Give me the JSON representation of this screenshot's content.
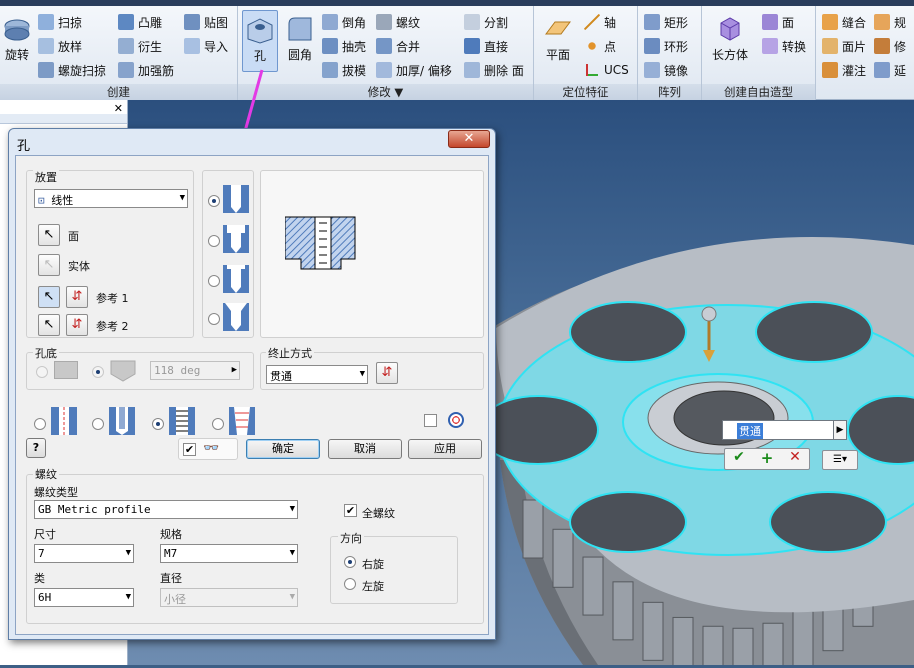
{
  "ribbon": {
    "groups": [
      {
        "label": "创建"
      },
      {
        "label": "修改 ▼"
      },
      {
        "label": "定位特征"
      },
      {
        "label": "阵列"
      },
      {
        "label": "创建自由造型"
      }
    ],
    "create": {
      "revolve": "旋转",
      "sweep": "扫掠",
      "loft": "放样",
      "coil": "螺旋扫掠",
      "emboss": "凸雕",
      "derive": "衍生",
      "rib": "加强筋",
      "decal": "贴图",
      "import": "导入"
    },
    "modify": {
      "hole": "孔",
      "fillet": "圆角",
      "chamfer": "倒角",
      "shell": "抽壳",
      "draft": "拔模",
      "thread": "螺纹",
      "combine": "合并",
      "thicken": "加厚/ 偏移",
      "split": "分割",
      "direct": "直接",
      "delete_face": "删除 面"
    },
    "work": {
      "plane": "平面",
      "axis": "轴",
      "point": "点",
      "ucs": "UCS"
    },
    "pattern": {
      "rect": "矩形",
      "circ": "环形",
      "mirror": "镜像"
    },
    "freeform": {
      "box": "长方体",
      "face": "面",
      "convert": "转换"
    },
    "surface": {
      "stitch": "缝合",
      "patch": "面片",
      "sculpt": "灌注",
      "rule": "规",
      "repair": "修",
      "extend": "延"
    }
  },
  "dialog": {
    "title": "孔",
    "close": "✕",
    "placement": {
      "label": "放置",
      "type": "线性",
      "face": "面",
      "solid": "实体",
      "ref1": "参考 1",
      "ref2": "参考 2"
    },
    "bottom": {
      "label": "孔底",
      "angle": "118 deg"
    },
    "termination": {
      "label": "终止方式",
      "value": "贯通"
    },
    "buttons": {
      "ok": "确定",
      "cancel": "取消",
      "apply": "应用",
      "help": "?"
    },
    "thread": {
      "label": "螺纹",
      "type_label": "螺纹类型",
      "type_value": "GB Metric profile",
      "full_thread": "全螺纹",
      "size_label": "尺寸",
      "size_value": "7",
      "designation_label": "规格",
      "designation_value": "M7",
      "class_label": "类",
      "class_value": "6H",
      "diameter_label": "直径",
      "diameter_value": "小径",
      "direction_label": "方向",
      "right_hand": "右旋",
      "left_hand": "左旋"
    }
  },
  "viewport": {
    "input_value": "贯通"
  },
  "colors": {
    "accent": "#3c7fb1",
    "viewport_bg": "#3d5f86",
    "highlight": "#60dce8",
    "arrow": "#e33ae5"
  }
}
